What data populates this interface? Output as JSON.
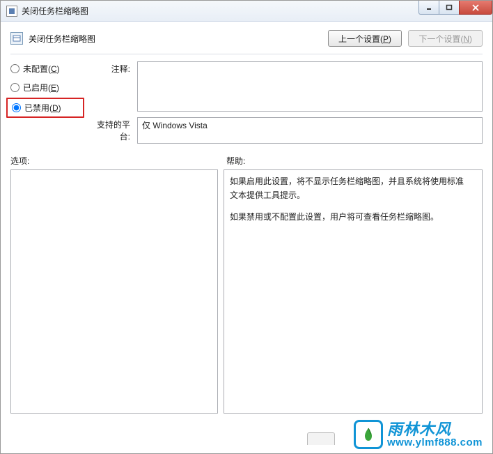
{
  "window": {
    "title": "关闭任务栏缩略图"
  },
  "header": {
    "policy_title": "关闭任务栏缩略图",
    "prev_button": "上一个设置(",
    "prev_key": "P",
    "prev_suffix": ")",
    "next_button": "下一个设置(",
    "next_key": "N",
    "next_suffix": ")"
  },
  "radios": {
    "not_configured": "未配置(",
    "not_configured_key": "C",
    "enabled": "已启用(",
    "enabled_key": "E",
    "disabled": "已禁用(",
    "disabled_key": "D",
    "close_paren": ")",
    "selected": "disabled"
  },
  "fields": {
    "comment_label": "注释:",
    "comment_value": "",
    "platform_label": "支持的平台:",
    "platform_value": "仅 Windows Vista"
  },
  "sections": {
    "options_label": "选项:",
    "help_label": "帮助:"
  },
  "help": {
    "para1": "如果启用此设置，将不显示任务栏缩略图，并且系统将使用标准文本提供工具提示。",
    "para2": "如果禁用或不配置此设置，用户将可查看任务栏缩略图。"
  },
  "watermark": {
    "title": "雨林木风",
    "url": "www.ylmf888.com"
  }
}
